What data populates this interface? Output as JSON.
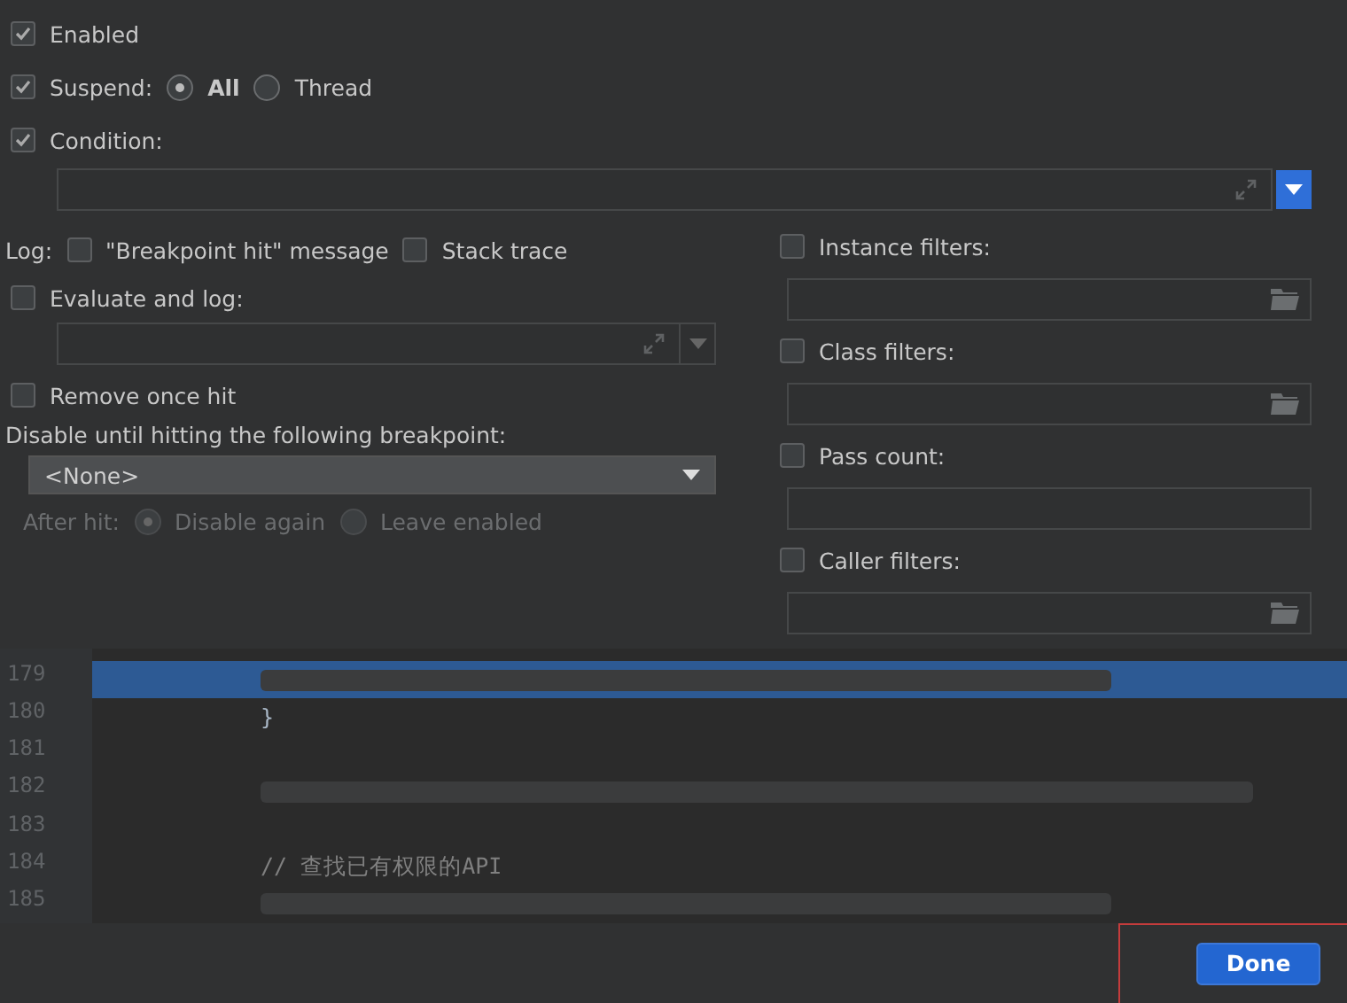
{
  "options": {
    "enabled": {
      "label": "Enabled",
      "checked": true
    },
    "suspend": {
      "label": "Suspend:",
      "checked": true,
      "choices": [
        {
          "label": "All",
          "selected": true
        },
        {
          "label": "Thread",
          "selected": false
        }
      ]
    },
    "condition": {
      "label": "Condition:",
      "checked": true
    }
  },
  "log": {
    "label": "Log:",
    "items": [
      {
        "label": "\"Breakpoint hit\" message",
        "checked": false
      },
      {
        "label": "Stack trace",
        "checked": false
      }
    ]
  },
  "evaluate": {
    "label": "Evaluate and log:",
    "checked": false
  },
  "remove_once_hit": {
    "label": "Remove once hit",
    "checked": false
  },
  "disable_until": {
    "label": "Disable until hitting the following breakpoint:",
    "value": "<None>"
  },
  "after_hit": {
    "label": "After hit:",
    "disabled": true,
    "choices": [
      {
        "label": "Disable again",
        "selected": true
      },
      {
        "label": "Leave enabled",
        "selected": false
      }
    ]
  },
  "filters": [
    {
      "label": "Instance filters:",
      "checked": false,
      "kind": "browse"
    },
    {
      "label": "Class filters:",
      "checked": false,
      "kind": "browse"
    },
    {
      "label": "Pass count:",
      "checked": false,
      "kind": "plain"
    },
    {
      "label": "Caller filters:",
      "checked": false,
      "kind": "browse"
    }
  ],
  "code": [
    {
      "number": "179",
      "redacted": true,
      "highlighted": true
    },
    {
      "number": "180",
      "text": "}",
      "highlighted": false
    },
    {
      "number": "181",
      "highlighted": false
    },
    {
      "number": "182",
      "redacted": true,
      "highlighted": false
    },
    {
      "number": "183",
      "highlighted": false
    },
    {
      "number": "184",
      "text": "// 查找已有权限的API",
      "kind": "comment",
      "highlighted": false
    },
    {
      "number": "185",
      "redacted": true,
      "highlighted": false
    }
  ],
  "done_button": "Done"
}
